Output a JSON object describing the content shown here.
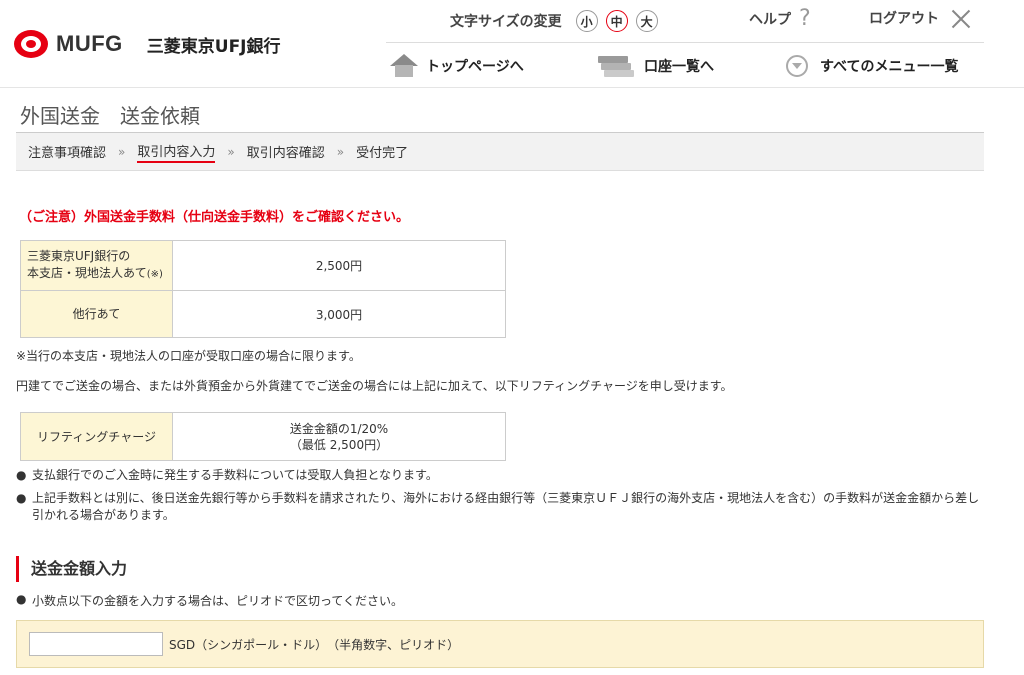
{
  "header": {
    "logo_text": "MUFG",
    "bank_name": "三菱東京UFJ銀行",
    "font_size_label": "文字サイズの変更",
    "font_sizes": [
      "小",
      "中",
      "大"
    ],
    "help_label": "ヘルプ",
    "help_glyph": "?",
    "logout_label": "ログアウト",
    "nav": {
      "home": "トップページへ",
      "accounts": "口座一覧へ",
      "menu": "すべてのメニュー一覧"
    }
  },
  "page": {
    "title": "外国送金　送金依頼",
    "steps": [
      "注意事項確認",
      "取引内容入力",
      "取引内容確認",
      "受付完了"
    ],
    "step_separator": "»",
    "notice": "（ご注意）外国送金手数料（仕向送金手数料）をご確認ください。"
  },
  "fee_table": {
    "rows": [
      {
        "label_line1": "三菱東京UFJ銀行の",
        "label_line2": "本支店・現地法人あて",
        "label_mark": "(※)",
        "value": "2,500円"
      },
      {
        "label": "他行あて",
        "value": "3,000円"
      }
    ]
  },
  "notes": {
    "note1": "※当行の本支店・現地法人の口座が受取口座の場合に限ります。",
    "note2": "円建てでご送金の場合、または外貨預金から外貨建てでご送金の場合には上記に加えて、以下リフティングチャージを申し受けます。"
  },
  "lifting_table": {
    "label": "リフティングチャージ",
    "value_line1": "送金金額の1/20%",
    "value_line2": "（最低 2,500円）"
  },
  "bullets": [
    "支払銀行でのご入金時に発生する手数料については受取人負担となります。",
    "上記手数料とは別に、後日送金先銀行等から手数料を請求されたり、海外における経由銀行等（三菱東京ＵＦＪ銀行の海外支店・現地法人を含む）の手数料が送金金額から差し引かれる場合があります。"
  ],
  "amount_section": {
    "heading": "送金金額入力",
    "instruction": "小数点以下の金額を入力する場合は、ピリオドで区切ってください。",
    "input_value": "",
    "suffix": "SGD（シンガポール・ドル）　（半角数字、ピリオド）"
  },
  "colors": {
    "brand_red": "#e60012",
    "label_bg": "#fdf6d5",
    "input_area_bg": "#fdf3d4"
  }
}
